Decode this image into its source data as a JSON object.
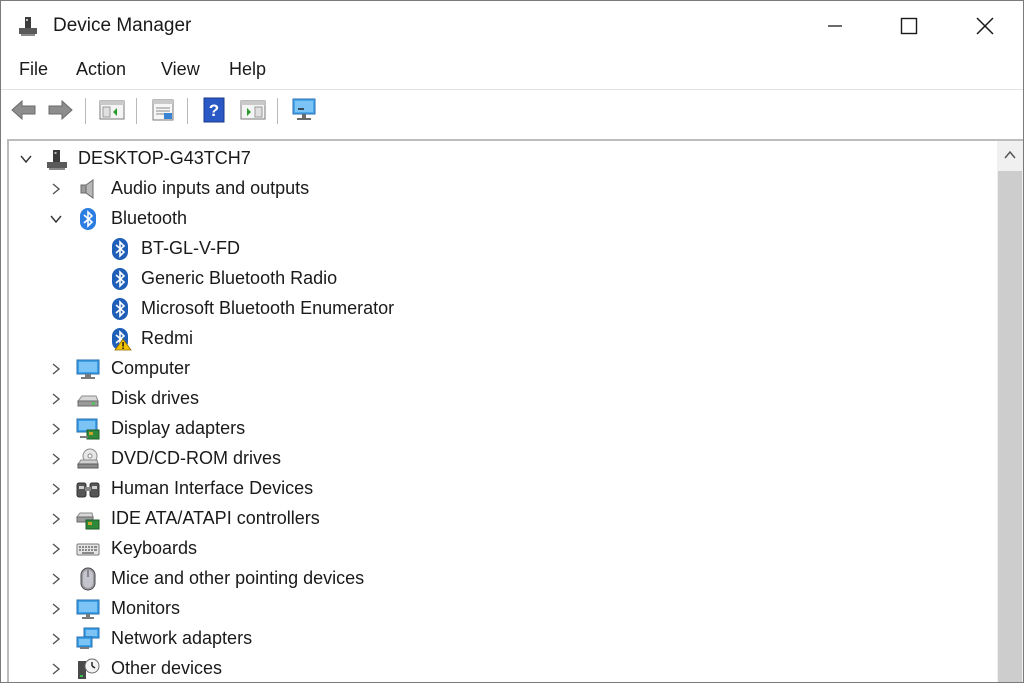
{
  "window": {
    "title": "Device Manager"
  },
  "menu": {
    "file": "File",
    "action": "Action",
    "view": "View",
    "help": "Help"
  },
  "toolbar": {
    "icons": [
      "back-arrow-icon",
      "forward-arrow-icon",
      "show-hide-console-tree-icon",
      "properties-icon",
      "help-icon",
      "action-pane-icon",
      "monitor-icon"
    ]
  },
  "tree": {
    "root": "DESKTOP-G43TCH7",
    "audio": "Audio inputs and outputs",
    "bluetooth": "Bluetooth",
    "bt_children": [
      "BT-GL-V-FD",
      "Generic Bluetooth Radio",
      "Microsoft Bluetooth Enumerator",
      "Redmi"
    ],
    "computer": "Computer",
    "disk": "Disk drives",
    "display": "Display adapters",
    "dvd": "DVD/CD-ROM drives",
    "hid": "Human Interface Devices",
    "ide": "IDE ATA/ATAPI controllers",
    "keyboards": "Keyboards",
    "mice": "Mice and other pointing devices",
    "monitors": "Monitors",
    "network": "Network adapters",
    "other": "Other devices"
  },
  "colors": {
    "bluetooth_blue": "#1f67c9",
    "warning_yellow": "#f2c200",
    "monitor_blue": "#3aa0e8"
  }
}
